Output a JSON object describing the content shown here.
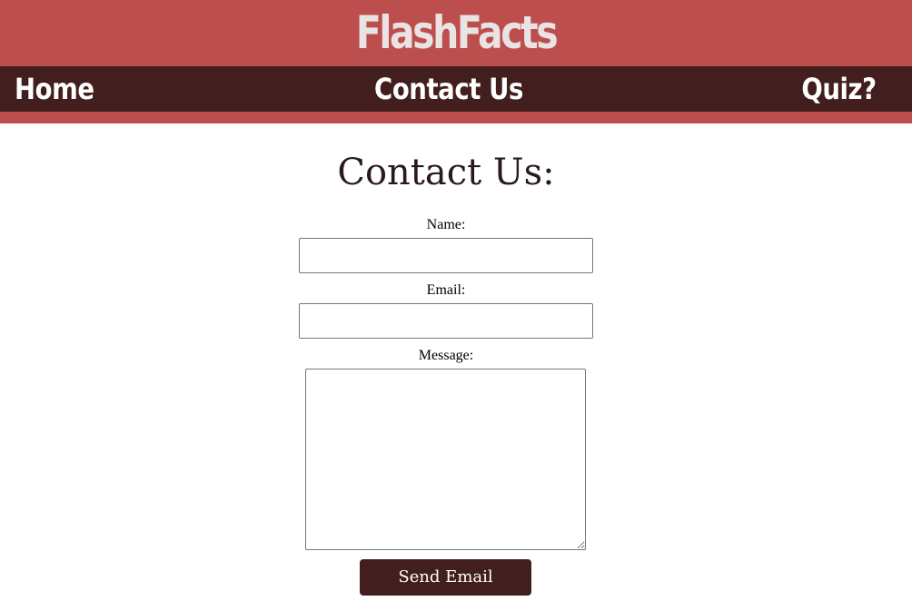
{
  "header": {
    "brand": "FlashFacts"
  },
  "nav": {
    "home": "Home",
    "contact": "Contact Us",
    "quiz": "Quiz?"
  },
  "main": {
    "title": "Contact Us:",
    "form": {
      "name_label": "Name:",
      "name_value": "",
      "email_label": "Email:",
      "email_value": "",
      "message_label": "Message:",
      "message_value": "",
      "submit_label": "Send Email"
    }
  },
  "colors": {
    "header_bg": "#bc4f4d",
    "nav_bg": "#421e1e",
    "brand_text": "#e9e3e3",
    "button_bg": "#421e1e"
  }
}
